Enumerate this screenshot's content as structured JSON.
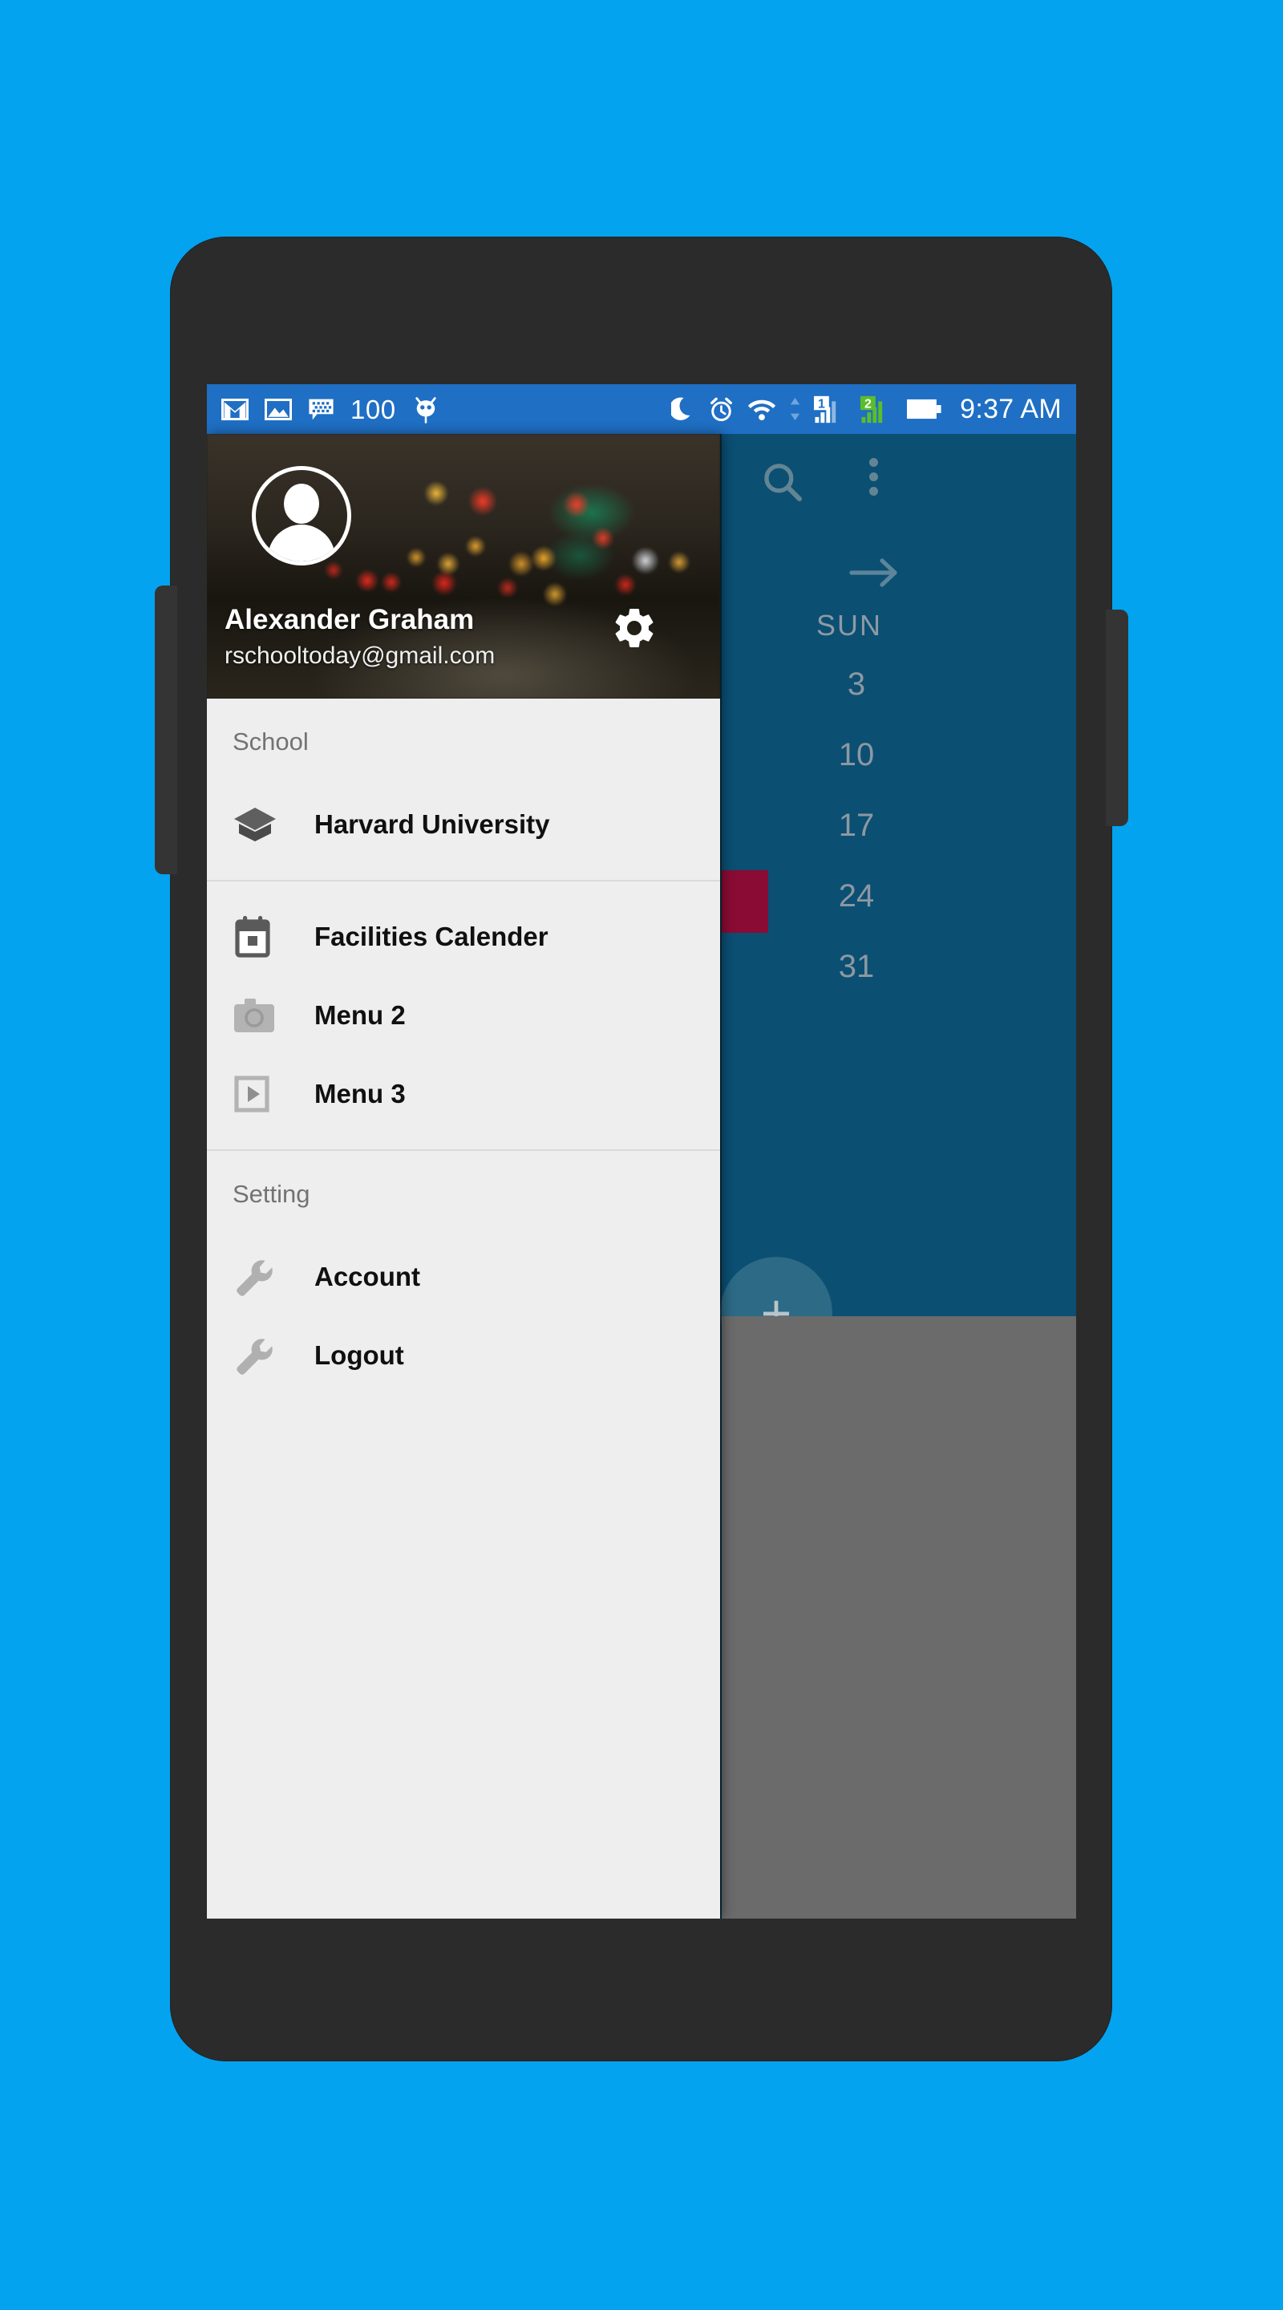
{
  "wallpaper": {
    "background_color": "#03a3f0"
  },
  "device": {
    "frame_color": "#2b2b2b"
  },
  "status_bar": {
    "background_color": "#1f6fc4",
    "left_icons": [
      {
        "name": "gmail-icon",
        "label": "M"
      },
      {
        "name": "photo-icon",
        "label": ""
      },
      {
        "name": "bbm-chat-icon",
        "label": ""
      },
      {
        "name": "notification-count",
        "label": "100"
      },
      {
        "name": "android-mascot-icon",
        "label": ""
      }
    ],
    "notification_count": "100",
    "right_icons": [
      {
        "name": "do-not-disturb-moon-icon",
        "label": ""
      },
      {
        "name": "alarm-clock-icon",
        "label": ""
      },
      {
        "name": "wifi-icon",
        "label": ""
      },
      {
        "name": "sim1-signal-icon",
        "label": "1"
      },
      {
        "name": "sim2-signal-icon",
        "label": "2"
      },
      {
        "name": "battery-icon",
        "label": ""
      }
    ],
    "sim1_label": "1",
    "sim2_label": "2",
    "clock": "9:37 AM"
  },
  "background_app": {
    "panel_color": "#0b4f73",
    "fab_color": "#2c6a86",
    "fab_label": "+",
    "weekday_header": "SUN",
    "dates": [
      "3",
      "10",
      "17",
      "24",
      "31"
    ],
    "event_block_color": "#8a0b33",
    "toolbar_icons": [
      {
        "name": "search-icon"
      },
      {
        "name": "overflow-menu-icon"
      },
      {
        "name": "next-arrow-icon"
      }
    ]
  },
  "drawer": {
    "background_color": "#eeeeee",
    "profile": {
      "name": "Alexander Graham",
      "email": "rschooltoday@gmail.com",
      "avatar_name": "user-avatar",
      "settings_icon": "gear-icon"
    },
    "sections": [
      {
        "header": "School",
        "items": [
          {
            "label": "Harvard University",
            "icon": "graduation-cap-icon"
          }
        ]
      },
      {
        "header": "",
        "items": [
          {
            "label": "Facilities Calender",
            "icon": "calendar-icon"
          },
          {
            "label": "Menu 2",
            "icon": "camera-icon"
          },
          {
            "label": "Menu 3",
            "icon": "video-play-icon"
          }
        ]
      },
      {
        "header": "Setting",
        "items": [
          {
            "label": "Account",
            "icon": "wrench-icon"
          },
          {
            "label": "Logout",
            "icon": "wrench-icon"
          }
        ]
      }
    ]
  }
}
